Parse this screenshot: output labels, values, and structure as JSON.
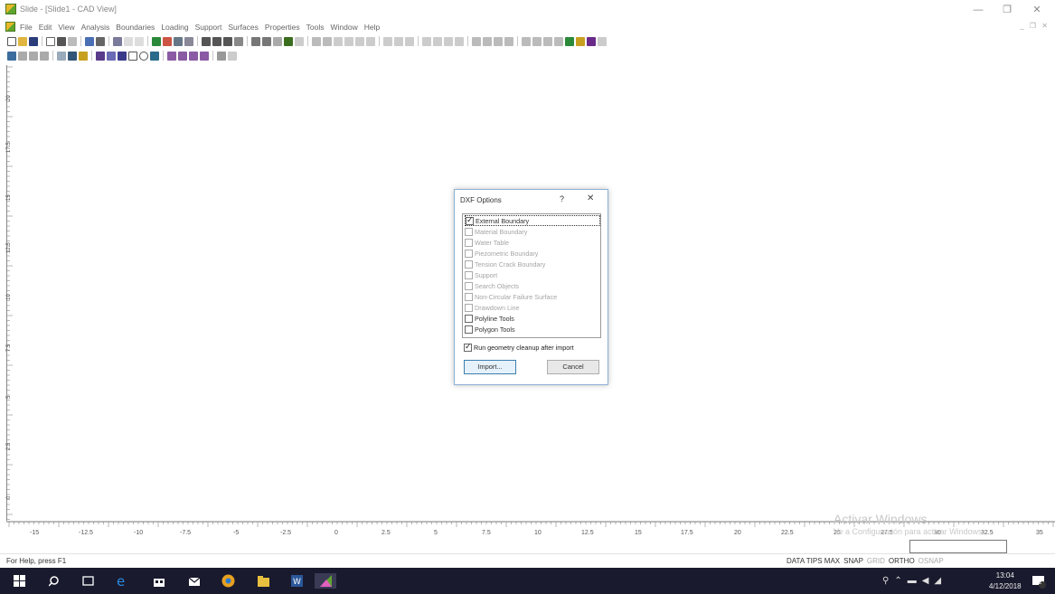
{
  "window": {
    "title": "Slide - [Slide1 - CAD View]",
    "controls": {
      "minimize": "—",
      "restore": "❐",
      "close": "✕"
    }
  },
  "menu": {
    "items": [
      "File",
      "Edit",
      "View",
      "Analysis",
      "Boundaries",
      "Loading",
      "Support",
      "Surfaces",
      "Properties",
      "Tools",
      "Window",
      "Help"
    ],
    "mdi_controls": "_ ❐ ✕"
  },
  "axes": {
    "y_labels": [
      "20",
      "17.5",
      "15",
      "12.5",
      "10",
      "7.5",
      "5",
      "2.5",
      "0"
    ],
    "x_labels": [
      "-15",
      "-12.5",
      "-10",
      "-7.5",
      "-5",
      "-2.5",
      "0",
      "2.5",
      "5",
      "7.5",
      "10",
      "12.5",
      "15",
      "17.5",
      "20",
      "22.5",
      "25",
      "27.5",
      "30",
      "32.5",
      "35"
    ]
  },
  "dialog": {
    "title": "DXF Options",
    "help_label": "?",
    "close_label": "✕",
    "items": [
      {
        "label": "External Boundary",
        "checked": true,
        "enabled": true
      },
      {
        "label": "Material Boundary",
        "checked": false,
        "enabled": false
      },
      {
        "label": "Water Table",
        "checked": false,
        "enabled": false
      },
      {
        "label": "Piezometric Boundary",
        "checked": false,
        "enabled": false
      },
      {
        "label": "Tension Crack Boundary",
        "checked": false,
        "enabled": false
      },
      {
        "label": "Support",
        "checked": false,
        "enabled": false
      },
      {
        "label": "Search Objects",
        "checked": false,
        "enabled": false
      },
      {
        "label": "Non-Circular Failure Surface",
        "checked": false,
        "enabled": false
      },
      {
        "label": "Drawdown Line",
        "checked": false,
        "enabled": false
      },
      {
        "label": "Polyline Tools",
        "checked": false,
        "enabled": true
      },
      {
        "label": "Polygon Tools",
        "checked": false,
        "enabled": true
      }
    ],
    "cleanup_label": "Run geometry cleanup after import",
    "import_label": "Import...",
    "cancel_label": "Cancel"
  },
  "watermark": {
    "line1": "Activar Windows",
    "line2": "Ve a Configuración para activar Windows."
  },
  "status": {
    "help": "For Help, press F1",
    "flags": [
      {
        "label": "DATA TIPS MAX",
        "active": true
      },
      {
        "label": "SNAP",
        "active": true
      },
      {
        "label": "GRID",
        "active": false
      },
      {
        "label": "ORTHO",
        "active": true
      },
      {
        "label": "OSNAP",
        "active": false
      }
    ]
  },
  "taskbar": {
    "time": "13:04",
    "date": "4/12/2018",
    "notification_count": "2"
  },
  "colors": {
    "dialog_border": "#8fb0d4",
    "taskbar_bg": "#1a1a2e",
    "accent_blue": "#3c7fb1"
  }
}
